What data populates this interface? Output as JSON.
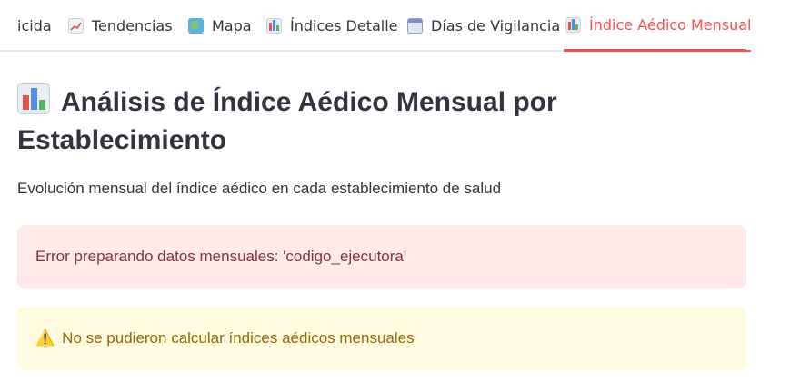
{
  "tabs": [
    {
      "label": "icida",
      "icon": "chart-icon",
      "active": false
    },
    {
      "label": "Tendencias",
      "icon": "trend-chart-icon",
      "active": false
    },
    {
      "label": "Mapa",
      "icon": "map-icon",
      "active": false
    },
    {
      "label": "Índices Detalle",
      "icon": "bar-chart-icon",
      "active": false
    },
    {
      "label": "Días de Vigilancia",
      "icon": "calendar-icon",
      "active": false
    },
    {
      "label": "Índice Aédico Mensual",
      "icon": "bar-chart-icon",
      "active": true
    }
  ],
  "page": {
    "title": "Análisis de Índice Aédico Mensual por Establecimiento",
    "title_icon": "bar-chart-icon",
    "subtitle": "Evolución mensual del índice aédico en cada establecimiento de salud"
  },
  "alerts": {
    "error": "Error preparando datos mensuales: 'codigo_ejecutora'",
    "warning": "No se pudieron calcular índices aédicos mensuales",
    "warning_icon": "⚠️"
  },
  "colors": {
    "accent": "#ff4b4b",
    "error_bg": "#ffe8e8",
    "error_text": "#7d353b",
    "warning_bg": "#fffbe0",
    "warning_text": "#926c05"
  }
}
